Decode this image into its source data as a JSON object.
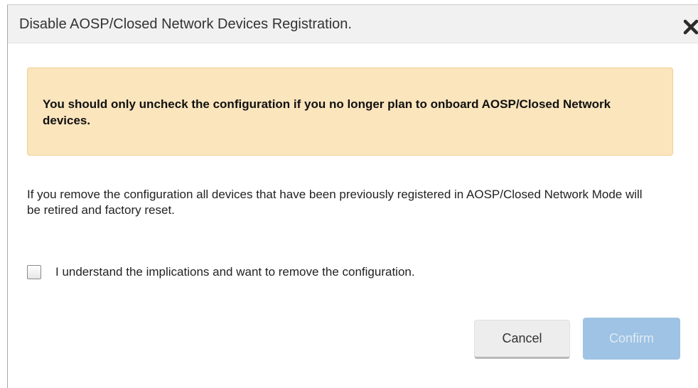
{
  "dialog": {
    "title": "Disable AOSP/Closed Network Devices Registration.",
    "close_icon": "close-icon"
  },
  "warning": {
    "text": "You should only uncheck the configuration if you no longer plan to onboard AOSP/Closed Network devices."
  },
  "info": {
    "text": "If you remove the configuration all devices that have been previously registered in AOSP/Closed Network Mode will be retired and factory reset."
  },
  "acknowledge": {
    "label": "I understand the implications and want to remove the configuration.",
    "checked": false
  },
  "buttons": {
    "cancel_label": "Cancel",
    "confirm_label": "Confirm",
    "confirm_enabled": false
  },
  "colors": {
    "header_bg": "#f1f1f1",
    "warning_bg": "#fbe5bd",
    "warning_border": "#f0cf8f",
    "confirm_disabled_bg": "#9ec3e4"
  }
}
